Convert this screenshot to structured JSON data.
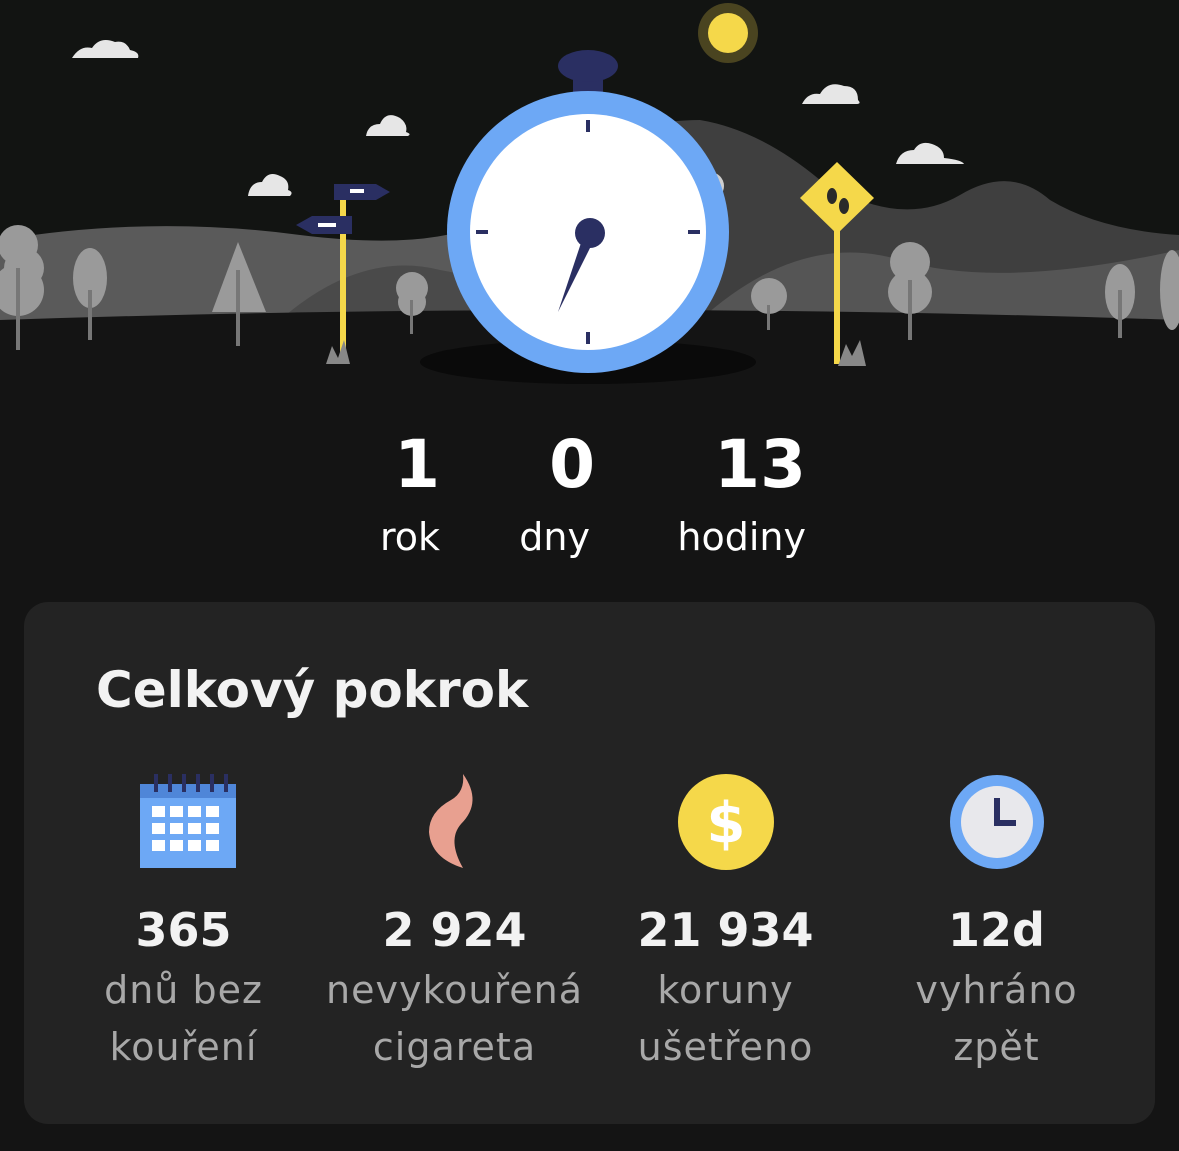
{
  "counter": {
    "years": {
      "value": "1",
      "label": "rok"
    },
    "days": {
      "value": "0",
      "label": "dny"
    },
    "hours": {
      "value": "13",
      "label": "hodiny"
    }
  },
  "progress": {
    "title": "Celkový pokrok",
    "stats": [
      {
        "icon": "calendar-icon",
        "value": "365",
        "label_line1": "dnů bez",
        "label_line2": "kouření"
      },
      {
        "icon": "flame-icon",
        "value": "2 924",
        "label_line1": "nevykouřená",
        "label_line2": "cigareta"
      },
      {
        "icon": "dollar-coin-icon",
        "value": "21 934",
        "label_line1": "koruny",
        "label_line2": "ušetřeno"
      },
      {
        "icon": "clock-icon",
        "value": "12d",
        "label_line1": "vyhráno",
        "label_line2": "zpět"
      }
    ]
  },
  "colors": {
    "background": "#141414",
    "card": "#232323",
    "stopwatch_ring": "#6da8f5",
    "sun": "#f5d84a",
    "flame": "#e8a090",
    "calendar": "#6da8f5"
  }
}
